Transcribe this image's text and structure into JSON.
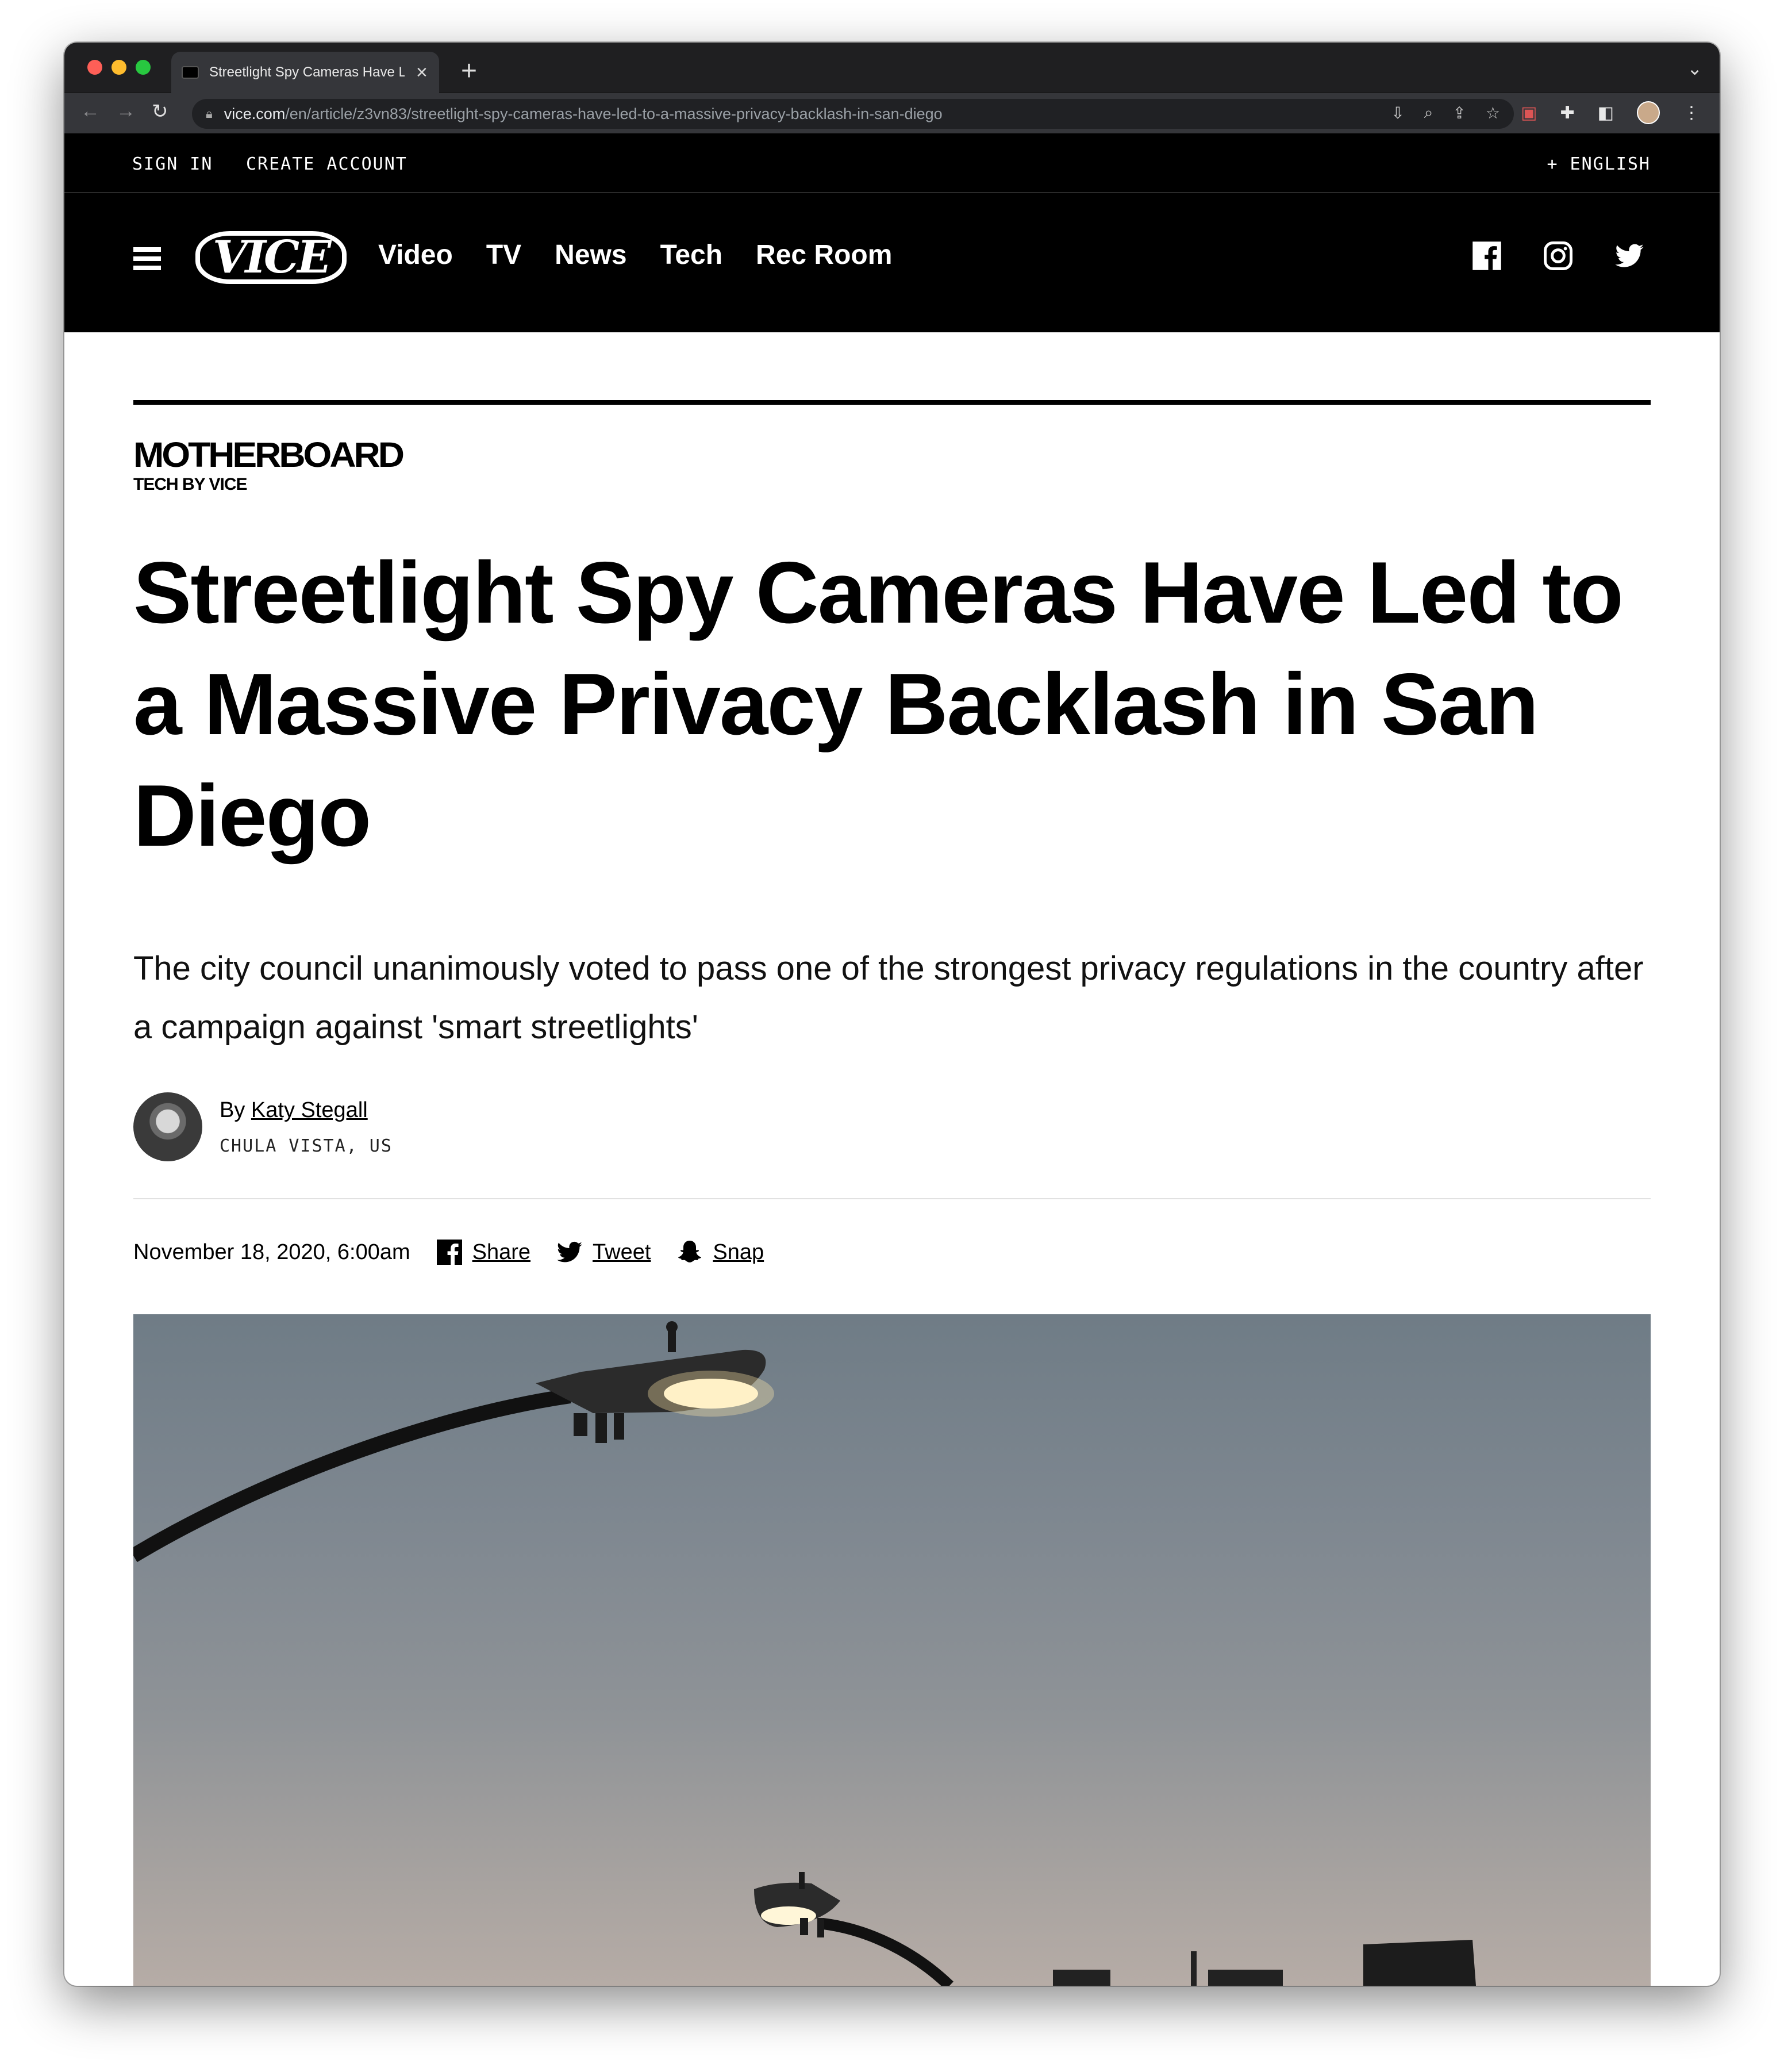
{
  "browser": {
    "tab_title": "Streetlight Spy Cameras Have Led to a Massive Privacy Backlash in San Diego",
    "url_host": "vice.com",
    "url_path": "/en/article/z3vn83/streetlight-spy-cameras-have-led-to-a-massive-privacy-backlash-in-san-diego"
  },
  "util": {
    "sign_in": "SIGN IN",
    "create_account": "CREATE ACCOUNT",
    "language": "+ ENGLISH"
  },
  "nav": {
    "logo": "VICE",
    "links": [
      "Video",
      "TV",
      "News",
      "Tech",
      "Rec Room"
    ]
  },
  "article": {
    "section_logo": "MOTHERBOARD",
    "section_sub": "TECH BY VICE",
    "headline": "Streetlight Spy Cameras Have Led to a Massive Privacy Backlash in San Diego",
    "dek": "The city council unanimously voted to pass one of the strongest privacy regulations in the country after a campaign against 'smart streetlights'",
    "byline_prefix": "By",
    "author": "Katy Stegall",
    "location": "CHULA VISTA, US",
    "date": "November 18, 2020, 6:00am",
    "share_label": "Share",
    "tweet_label": "Tweet",
    "snap_label": "Snap"
  }
}
